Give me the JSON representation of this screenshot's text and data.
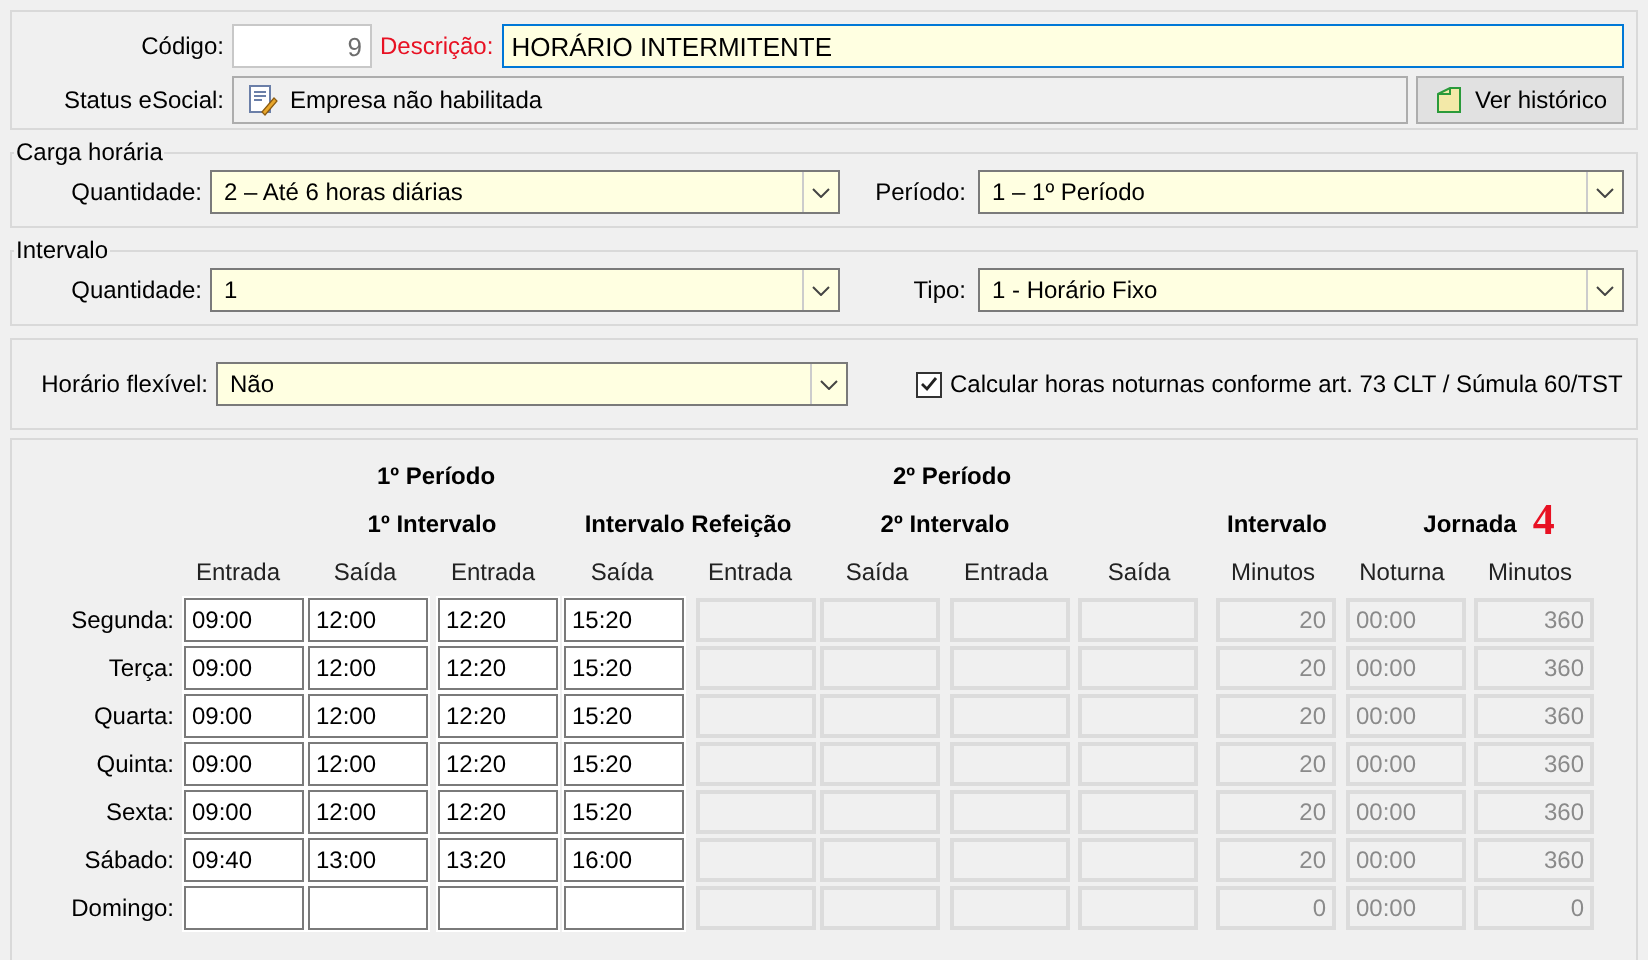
{
  "codigo": {
    "label": "Código:",
    "value": "9"
  },
  "descricao": {
    "label": "Descrição:",
    "value": "HORÁRIO INTERMITENTE"
  },
  "status": {
    "label": "Status eSocial:",
    "value": "Empresa não habilitada"
  },
  "history_button": "Ver histórico",
  "groups": [
    {
      "title": "Carga horária",
      "fields": [
        {
          "label": "Quantidade:",
          "value": "2 – Até 6 horas diárias"
        },
        {
          "label": "Período:",
          "value": "1 – 1º Período"
        }
      ]
    },
    {
      "title": "Intervalo",
      "fields": [
        {
          "label": "Quantidade:",
          "value": "1"
        },
        {
          "label": "Tipo:",
          "value": "1 - Horário Fixo"
        }
      ]
    }
  ],
  "flexivel": {
    "label": "Horário flexível:",
    "value": "Não"
  },
  "noturnas": {
    "label": "Calcular horas noturnas conforme art. 73 CLT / Súmula 60/TST",
    "checked": true
  },
  "schedule": {
    "header_row_1": [
      "1º Período",
      "2º Período"
    ],
    "header_row_2": [
      "1º Intervalo",
      "Intervalo Refeição",
      "2º Intervalo",
      "Intervalo",
      "Jornada"
    ],
    "columns": [
      "Entrada",
      "Saída",
      "Entrada",
      "Saída",
      "Entrada",
      "Saída",
      "Entrada",
      "Saída",
      "Minutos",
      "Noturna",
      "Minutos"
    ],
    "annotation": "4",
    "rows": [
      {
        "day": "Segunda:",
        "cells": [
          {
            "value": "09:00",
            "disabled": false
          },
          {
            "value": "12:00",
            "disabled": false
          },
          {
            "value": "12:20",
            "disabled": false
          },
          {
            "value": "15:20",
            "disabled": false
          },
          {
            "disabled": true
          },
          {
            "disabled": true
          },
          {
            "disabled": true
          },
          {
            "disabled": true
          }
        ],
        "interval": "20",
        "night": "00:00",
        "total": "360"
      },
      {
        "day": "Terça:",
        "cells": [
          {
            "value": "09:00",
            "disabled": false
          },
          {
            "value": "12:00",
            "disabled": false
          },
          {
            "value": "12:20",
            "disabled": false
          },
          {
            "value": "15:20",
            "disabled": false
          },
          {
            "disabled": true
          },
          {
            "disabled": true
          },
          {
            "disabled": true
          },
          {
            "disabled": true
          }
        ],
        "interval": "20",
        "night": "00:00",
        "total": "360"
      },
      {
        "day": "Quarta:",
        "cells": [
          {
            "value": "09:00",
            "disabled": false
          },
          {
            "value": "12:00",
            "disabled": false
          },
          {
            "value": "12:20",
            "disabled": false
          },
          {
            "value": "15:20",
            "disabled": false
          },
          {
            "disabled": true
          },
          {
            "disabled": true
          },
          {
            "disabled": true
          },
          {
            "disabled": true
          }
        ],
        "interval": "20",
        "night": "00:00",
        "total": "360"
      },
      {
        "day": "Quinta:",
        "cells": [
          {
            "value": "09:00",
            "disabled": false
          },
          {
            "value": "12:00",
            "disabled": false
          },
          {
            "value": "12:20",
            "disabled": false
          },
          {
            "value": "15:20",
            "disabled": false
          },
          {
            "disabled": true
          },
          {
            "disabled": true
          },
          {
            "disabled": true
          },
          {
            "disabled": true
          }
        ],
        "interval": "20",
        "night": "00:00",
        "total": "360"
      },
      {
        "day": "Sexta:",
        "cells": [
          {
            "value": "09:00",
            "disabled": false
          },
          {
            "value": "12:00",
            "disabled": false
          },
          {
            "value": "12:20",
            "disabled": false
          },
          {
            "value": "15:20",
            "disabled": false
          },
          {
            "disabled": true
          },
          {
            "disabled": true
          },
          {
            "disabled": true
          },
          {
            "disabled": true
          }
        ],
        "interval": "20",
        "night": "00:00",
        "total": "360"
      },
      {
        "day": "Sábado:",
        "cells": [
          {
            "value": "09:40",
            "disabled": false
          },
          {
            "value": "13:00",
            "disabled": false
          },
          {
            "value": "13:20",
            "disabled": false
          },
          {
            "value": "16:00",
            "disabled": false
          },
          {
            "disabled": true
          },
          {
            "disabled": true
          },
          {
            "disabled": true
          },
          {
            "disabled": true
          }
        ],
        "interval": "20",
        "night": "00:00",
        "total": "360"
      },
      {
        "day": "Domingo:",
        "cells": [
          {
            "disabled": false
          },
          {
            "disabled": false
          },
          {
            "disabled": false
          },
          {
            "disabled": false
          },
          {
            "disabled": true
          },
          {
            "disabled": true
          },
          {
            "disabled": true
          },
          {
            "disabled": true
          }
        ],
        "interval": "0",
        "night": "00:00",
        "total": "0"
      }
    ]
  }
}
